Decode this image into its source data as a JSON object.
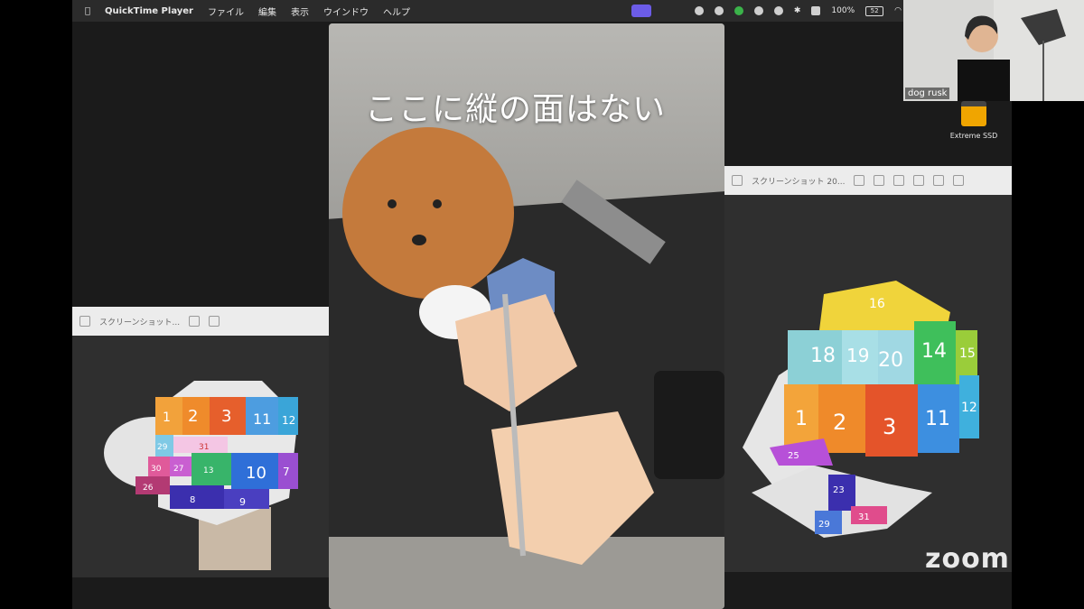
{
  "menubar": {
    "app_name": "QuickTime Player",
    "menus": [
      "ファイル",
      "編集",
      "表示",
      "ウインドウ",
      "ヘルプ"
    ],
    "battery": "100%",
    "battery_badge": "52"
  },
  "left_window": {
    "title": "スクリーンショット...",
    "faces": [
      "1",
      "2",
      "3",
      "11",
      "12",
      "29",
      "30",
      "27",
      "13",
      "10",
      "7",
      "26",
      "8",
      "9",
      "31"
    ]
  },
  "right_window": {
    "title": "スクリーンショット 20...",
    "faces": [
      "16",
      "18",
      "19",
      "20",
      "14",
      "15",
      "1",
      "2",
      "3",
      "11",
      "12",
      "25",
      "23",
      "29",
      "31"
    ]
  },
  "video": {
    "caption": "ここに縦の面はない"
  },
  "participant": {
    "name": "dog rusk"
  },
  "desktop": {
    "drive_label": "Extreme SSD"
  },
  "zoom": {
    "logo": "zoom"
  }
}
